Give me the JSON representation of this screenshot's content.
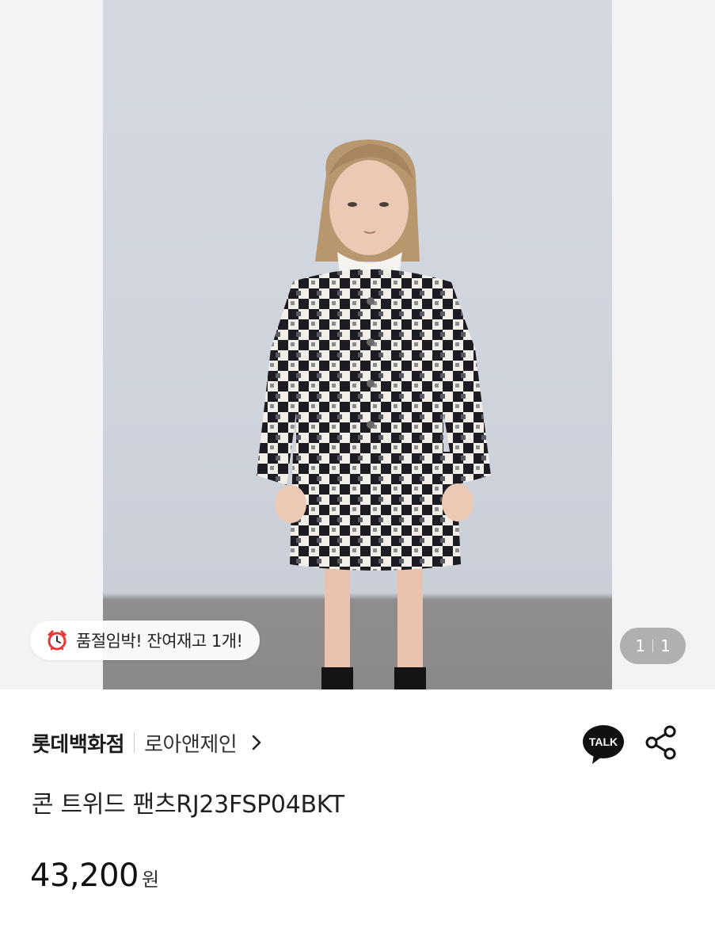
{
  "hero": {
    "stock_badge": {
      "icon": "alarm-clock-icon",
      "text": "품절임박! 잔여재고 1개!"
    },
    "page_indicator": {
      "current": "1",
      "total": "1"
    }
  },
  "product": {
    "store": "롯데백화점",
    "brand": "로아앤제인",
    "title": "콘 트위드 팬츠RJ23FSP04BKT",
    "price": "43,200",
    "currency": "원"
  },
  "actions": {
    "talk_label": "TALK",
    "share_icon": "share-icon"
  },
  "colors": {
    "accent_red": "#e53935",
    "talk_bg": "#111111"
  }
}
